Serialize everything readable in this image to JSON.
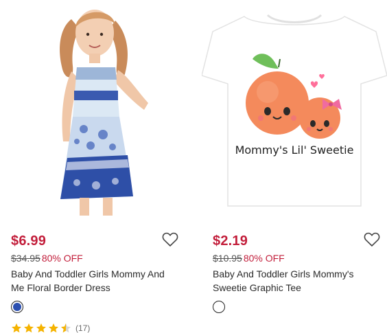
{
  "products": [
    {
      "price": "$6.99",
      "original_price": "$34.95",
      "discount": "80% OFF",
      "title": "Baby And Toddler Girls Mommy And Me Floral Border Dress",
      "swatch_color": "#2b4fb0",
      "rating": 4.5,
      "review_count": "(17)",
      "image": "girl-in-blue-floral-dress-photo",
      "wishlist_icon": "heart-outline-icon"
    },
    {
      "price": "$2.19",
      "original_price": "$10.95",
      "discount": "80% OFF",
      "title": "Baby And Toddler Girls Mommy's Sweetie Graphic Tee",
      "graphic_text": "Mommy's Lil' Sweetie",
      "swatch_color": "#ffffff",
      "image": "white-tee-with-two-oranges-graphic",
      "wishlist_icon": "heart-outline-icon"
    }
  ],
  "colors": {
    "sale_red": "#c21d3a",
    "star_gold": "#f5b301",
    "star_empty": "#d6d6d6"
  }
}
